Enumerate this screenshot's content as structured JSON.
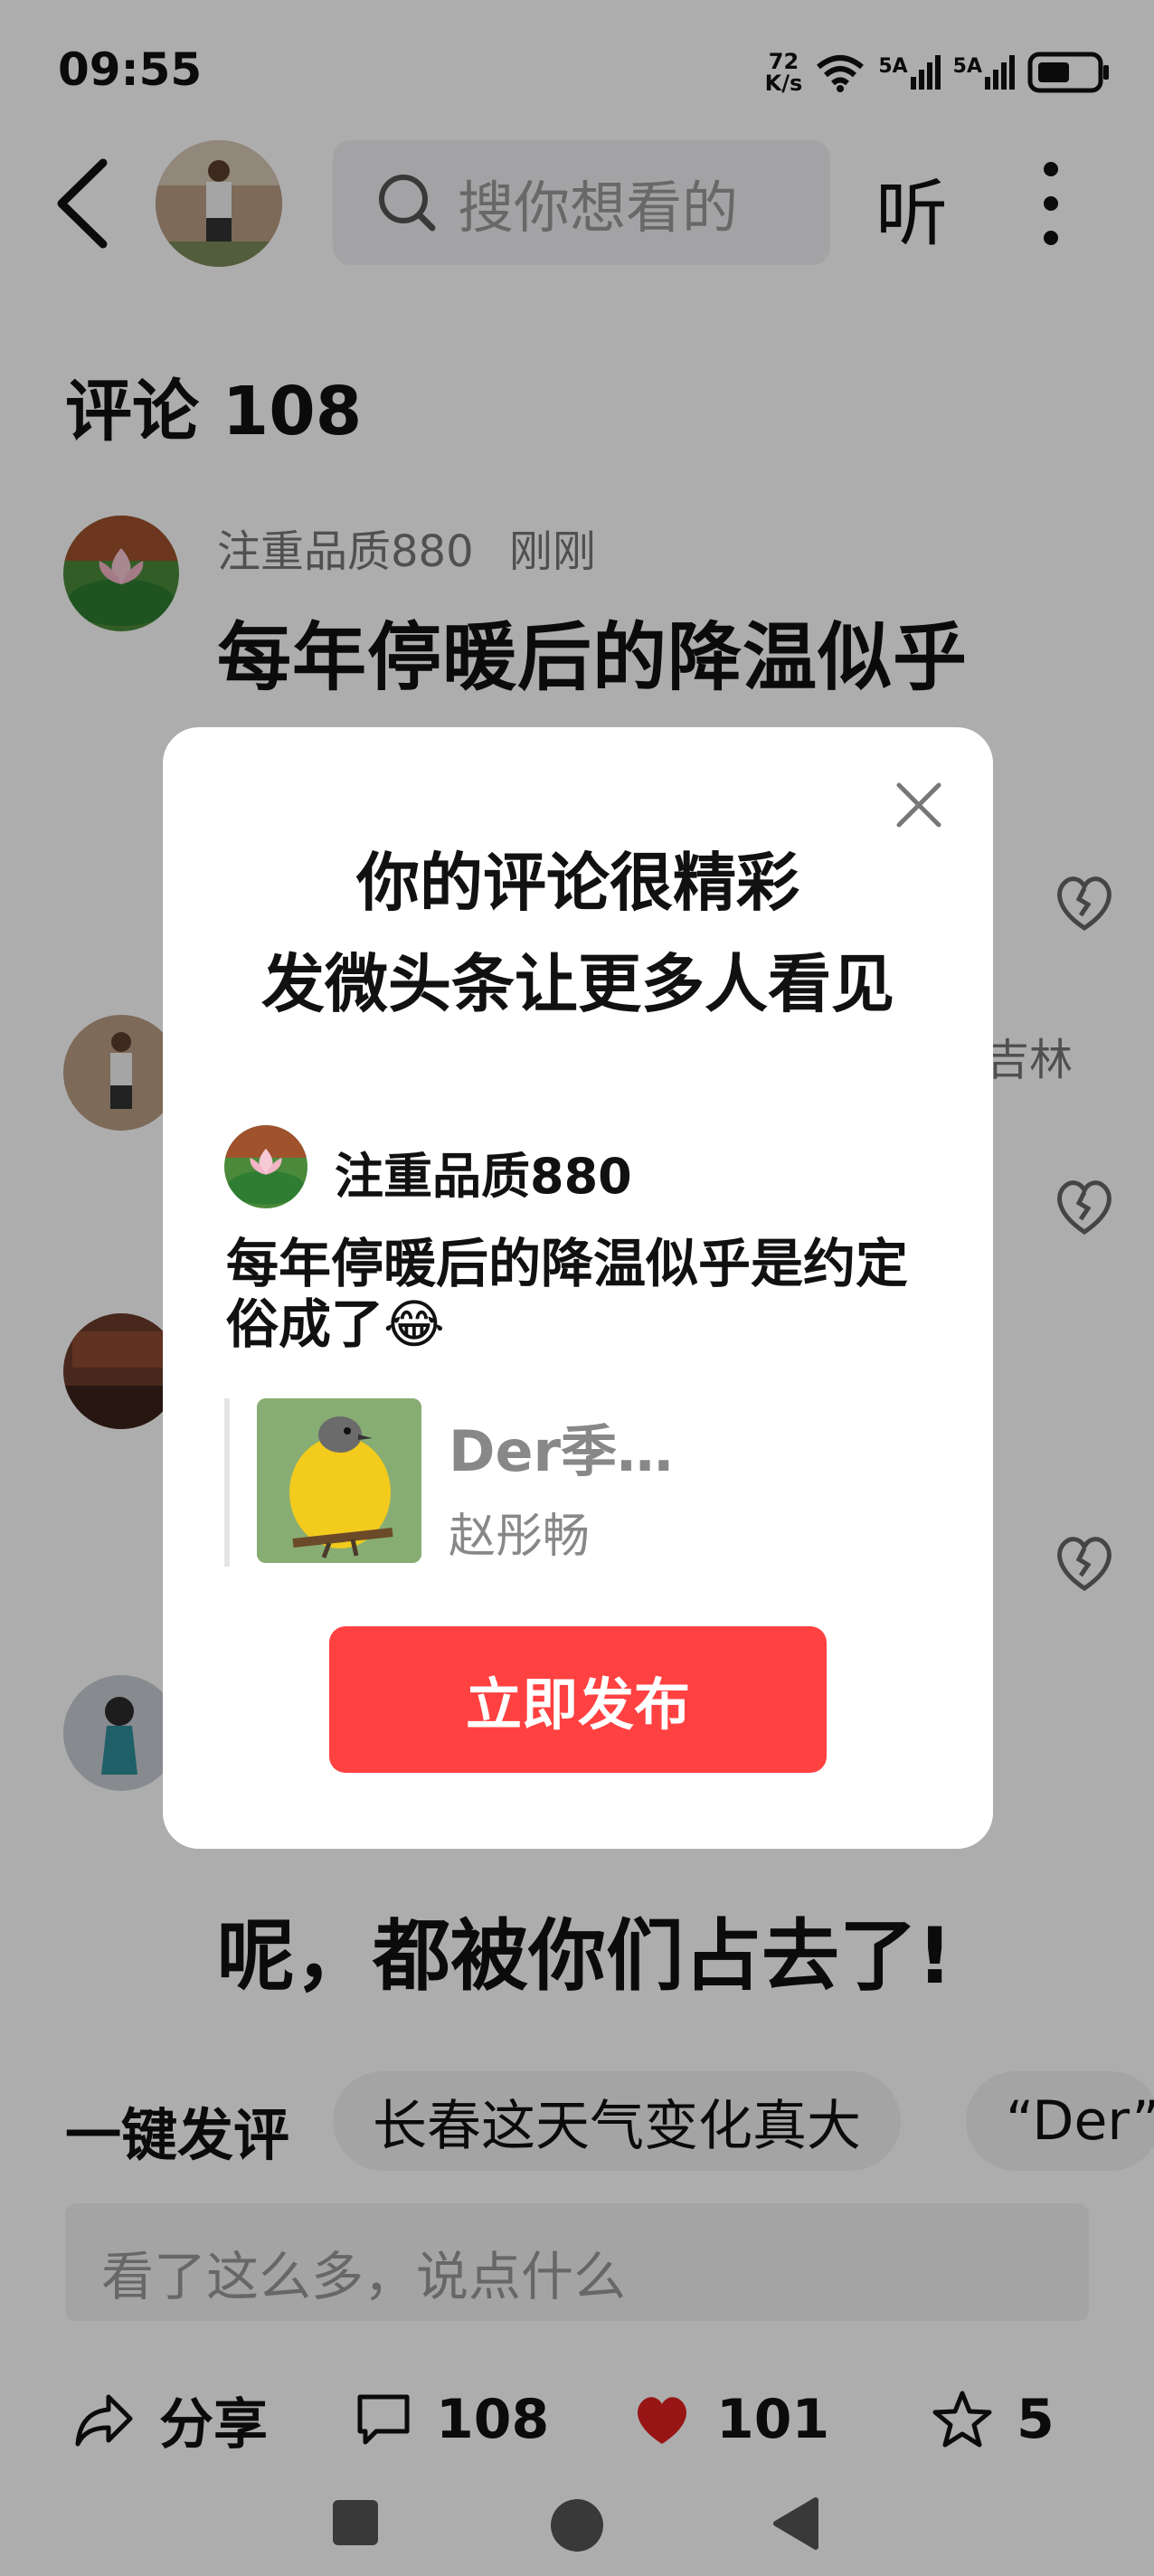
{
  "status_bar": {
    "time": "09:55",
    "net_speed_value": "72",
    "net_speed_unit": "K/s",
    "signal1": "5A",
    "signal2": "5A"
  },
  "header": {
    "search_placeholder": "搜你想看的",
    "listen_label": "听"
  },
  "comments": {
    "title": "评论 108",
    "first": {
      "author": "注重品质880",
      "time": "刚刚",
      "text": "每年停暖后的降温似乎"
    },
    "peek_text": "吉林",
    "bottom_text": "呢，都被你们占去了!"
  },
  "quick_reply": {
    "label": "一键发评",
    "chips": [
      "长春这天气变化真大",
      "“Der”"
    ]
  },
  "comment_input": {
    "placeholder": "看了这么多，说点什么"
  },
  "actions": {
    "share": "分享",
    "comments": "108",
    "likes": "101",
    "favorites": "5"
  },
  "dialog": {
    "title_line1": "你的评论很精彩",
    "title_line2": "发微头条让更多人看见",
    "author": "注重品质880",
    "text": "每年停暖后的降温似乎是约定俗成了😂",
    "quote_title": "Der季…",
    "quote_author": "赵彤畅",
    "publish_button": "立即发布"
  },
  "colors": {
    "accent_red": "#ff4141",
    "heart_red": "#e02020"
  }
}
